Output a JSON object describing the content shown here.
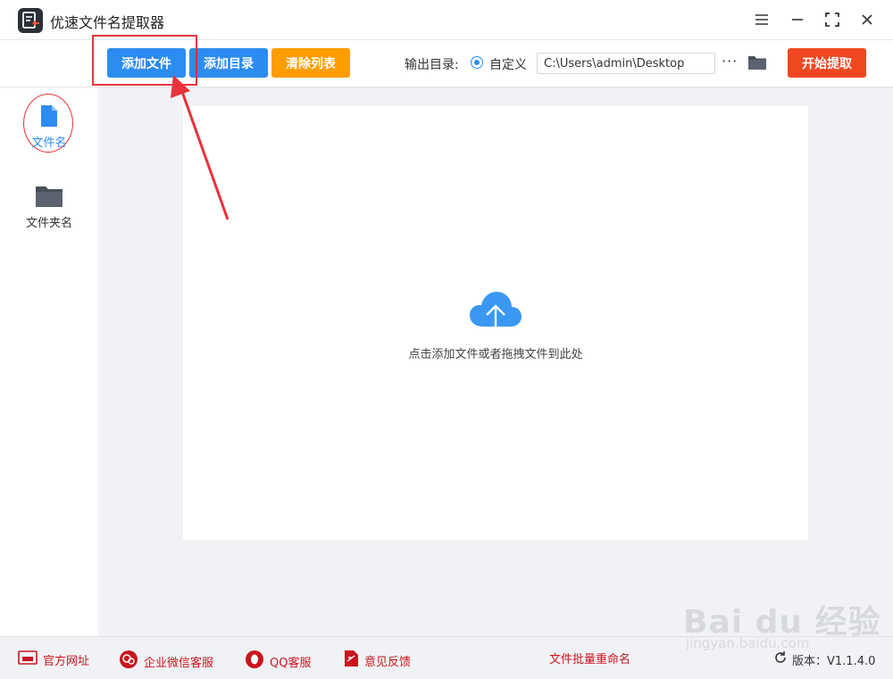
{
  "app": {
    "title": "优速文件名提取器"
  },
  "window_controls": [
    "menu-icon",
    "minimize-icon",
    "maximize-icon",
    "close-icon"
  ],
  "toolbar": {
    "add_file": "添加文件",
    "add_dir": "添加目录",
    "clear_list": "清除列表",
    "output_label": "输出目录:",
    "radio_custom": "自定义",
    "output_path": "C:\\Users\\admin\\Desktop",
    "more": "···",
    "start": "开始提取"
  },
  "sidebar": {
    "items": [
      {
        "label": "文件名",
        "icon": "file-icon",
        "active": true
      },
      {
        "label": "文件夹名",
        "icon": "folder-icon",
        "active": false
      }
    ]
  },
  "main": {
    "hint": "点击添加文件或者拖拽文件到此处"
  },
  "footer": {
    "links": [
      "官方网址",
      "企业微信客服",
      "QQ客服",
      "意见反馈"
    ],
    "center_link": "文件批量重命名",
    "version": "版本：V1.1.4.0"
  },
  "watermark": {
    "brand": "Bai du 经验",
    "url": "jingyan.baidu.com"
  },
  "colors": {
    "primary_blue": "#2d8cf0",
    "orange": "#ff9c00",
    "start_red": "#f14821",
    "annotation_red": "#e8323c",
    "footer_link_red": "#c8161d"
  }
}
